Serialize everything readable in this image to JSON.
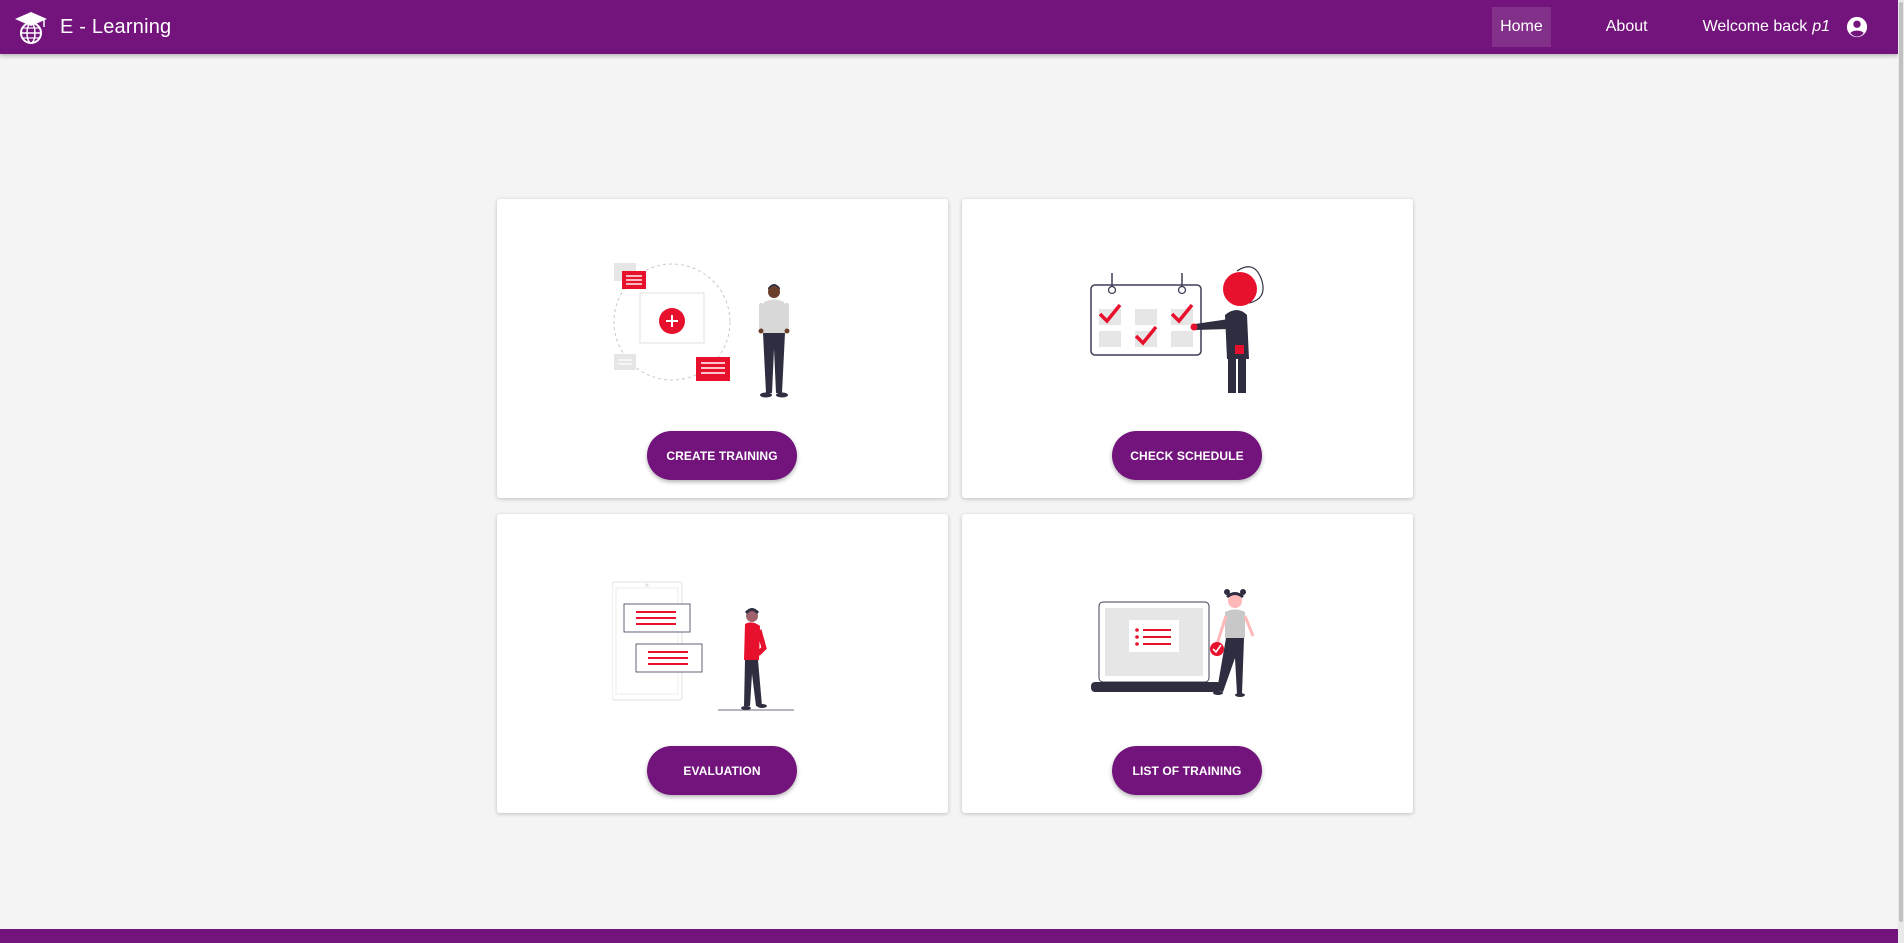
{
  "navbar": {
    "brand": "E - Learning",
    "links": [
      {
        "label": "Home",
        "active": true
      },
      {
        "label": "About",
        "active": false
      }
    ],
    "welcome_text": "Welcome back",
    "username": "p1"
  },
  "cards": [
    {
      "button_label": "CREATE TRAINING"
    },
    {
      "button_label": "CHECK SCHEDULE"
    },
    {
      "button_label": "EVALUATION"
    },
    {
      "button_label": "LIST OF TRAINING"
    }
  ],
  "colors": {
    "primary": "#72147c",
    "accent": "#e8112d",
    "background": "#f4f4f4",
    "card": "#ffffff",
    "dark": "#2f2e41"
  },
  "icons": {
    "brand": "graduation-globe-icon",
    "account": "account-circle-icon"
  }
}
